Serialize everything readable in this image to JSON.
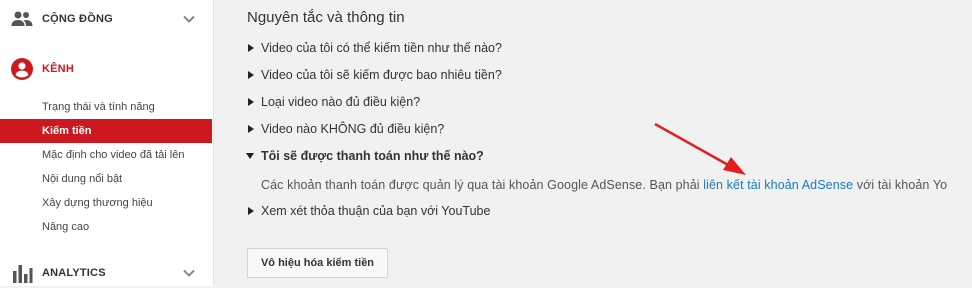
{
  "sidebar": {
    "community": {
      "label": "CỘNG ĐỒNG",
      "icon": "people-icon"
    },
    "channel": {
      "label": "KÊNH",
      "icon": "account-circle-icon",
      "items": [
        {
          "label": "Trạng thái và tính năng"
        },
        {
          "label": "Kiếm tiền",
          "selected": true
        },
        {
          "label": "Mặc định cho video đã tải lên"
        },
        {
          "label": "Nội dung nổi bật"
        },
        {
          "label": "Xây dựng thương hiệu"
        },
        {
          "label": "Nâng cao"
        }
      ]
    },
    "analytics": {
      "label": "ANALYTICS",
      "icon": "bar-chart-icon"
    }
  },
  "main": {
    "title": "Nguyên tắc và thông tin",
    "faqs": [
      {
        "label": "Video của tôi có thể kiếm tiền như thế nào?",
        "open": false
      },
      {
        "label": "Video của tôi sẽ kiếm được bao nhiêu tiền?",
        "open": false
      },
      {
        "label": "Loại video nào đủ điều kiện?",
        "open": false
      },
      {
        "label": "Video nào KHÔNG đủ điều kiện?",
        "open": false
      },
      {
        "label": "Tôi sẽ được thanh toán như thế nào?",
        "open": true
      },
      {
        "label": "Xem xét thỏa thuận của bạn với YouTube",
        "open": false
      }
    ],
    "answer": {
      "before": "Các khoản thanh toán được quản lý qua tài khoản Google AdSense. Bạn phải ",
      "link": "liên kết tài khoản AdSense",
      "after": " với tài khoản Yo"
    },
    "disable_button": "Vô hiệu hóa kiếm tiền"
  },
  "colors": {
    "accent": "#cc181e",
    "link": "#167ac6",
    "annotation_arrow": "#e02020"
  }
}
